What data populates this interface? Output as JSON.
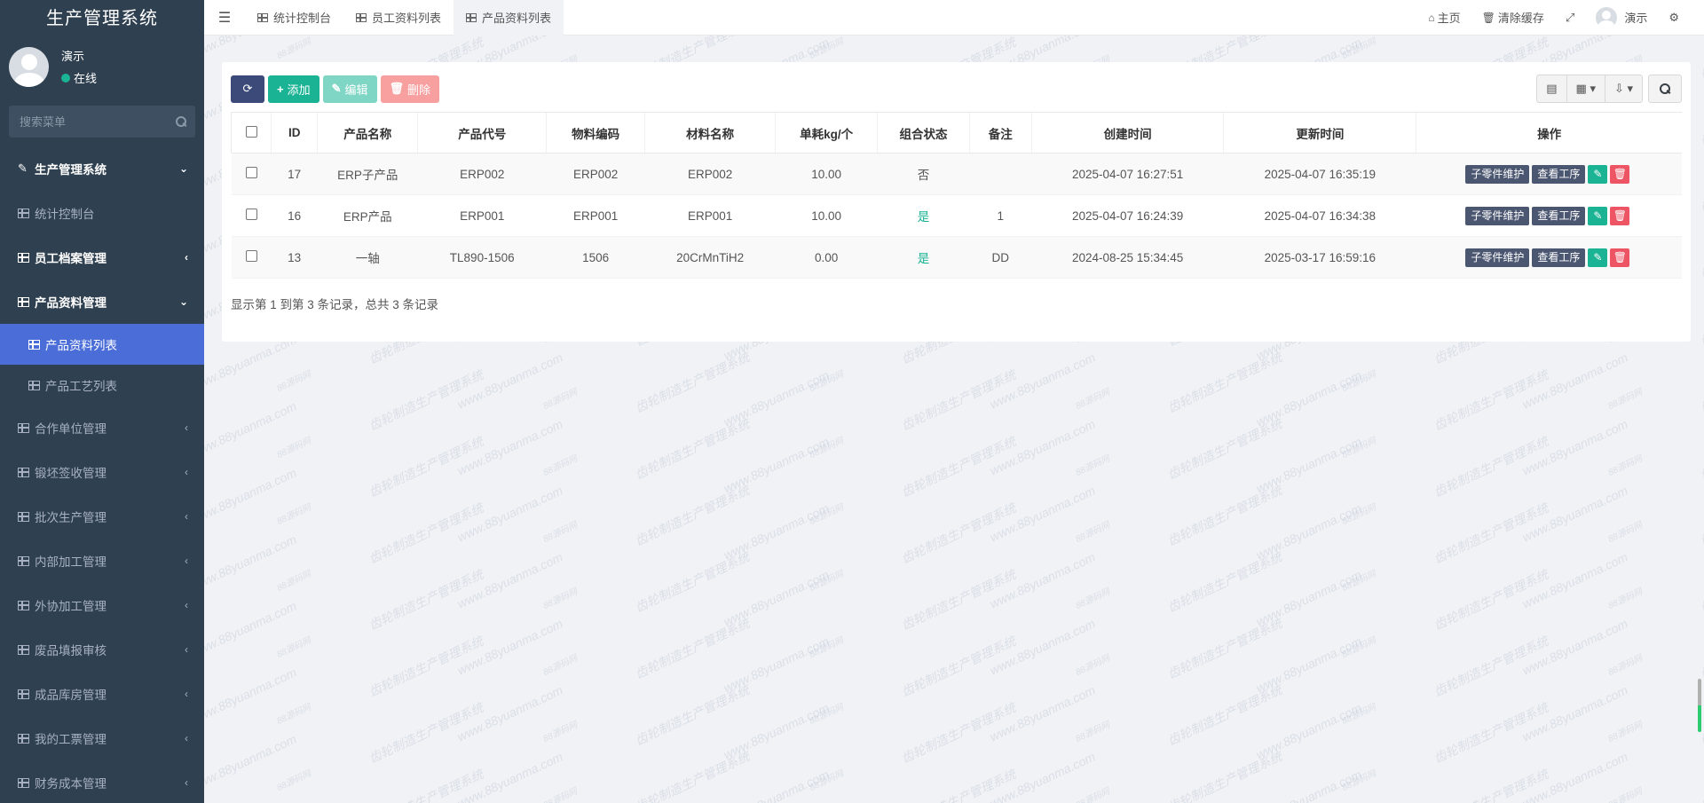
{
  "app": {
    "title": "生产管理系统"
  },
  "user": {
    "name": "演示",
    "status": "在线"
  },
  "sidebar": {
    "search_placeholder": "搜索菜单",
    "items": [
      {
        "label": "生产管理系统",
        "icon": "pencil-icon",
        "caret": "⌄",
        "bold": true
      },
      {
        "label": "统计控制台",
        "icon": "grid-icon",
        "caret": ""
      },
      {
        "label": "员工档案管理",
        "icon": "grid-icon",
        "caret": "‹",
        "bold": true
      },
      {
        "label": "产品资料管理",
        "icon": "grid-icon",
        "caret": "⌄",
        "bold": true
      },
      {
        "label": "产品资料列表",
        "icon": "grid-icon",
        "caret": "",
        "sub": true,
        "active": true
      },
      {
        "label": "产品工艺列表",
        "icon": "grid-icon",
        "caret": "",
        "sub": true
      },
      {
        "label": "合作单位管理",
        "icon": "grid-icon",
        "caret": "‹"
      },
      {
        "label": "锻坯签收管理",
        "icon": "grid-icon",
        "caret": "‹"
      },
      {
        "label": "批次生产管理",
        "icon": "grid-icon",
        "caret": "‹"
      },
      {
        "label": "内部加工管理",
        "icon": "grid-icon",
        "caret": "‹"
      },
      {
        "label": "外协加工管理",
        "icon": "grid-icon",
        "caret": "‹"
      },
      {
        "label": "废品填报审核",
        "icon": "grid-icon",
        "caret": "‹"
      },
      {
        "label": "成品库房管理",
        "icon": "grid-icon",
        "caret": "‹"
      },
      {
        "label": "我的工票管理",
        "icon": "grid-icon",
        "caret": "‹"
      },
      {
        "label": "财务成本管理",
        "icon": "grid-icon",
        "caret": "‹"
      }
    ]
  },
  "header": {
    "tabs": [
      {
        "label": "统计控制台",
        "active": false
      },
      {
        "label": "员工资料列表",
        "active": false
      },
      {
        "label": "产品资料列表",
        "active": true
      }
    ],
    "home_label": "主页",
    "clear_cache_label": "清除缓存",
    "user_label": "演示"
  },
  "toolbar": {
    "add_label": "添加",
    "edit_label": "编辑",
    "delete_label": "删除"
  },
  "table": {
    "columns": [
      "ID",
      "产品名称",
      "产品代号",
      "物料编码",
      "材料名称",
      "单耗kg/个",
      "组合状态",
      "备注",
      "创建时间",
      "更新时间",
      "操作"
    ],
    "rows": [
      {
        "id": "17",
        "name": "ERP子产品",
        "code": "ERP002",
        "material_code": "ERP002",
        "material_name": "ERP002",
        "consumption": "10.00",
        "combo": "否",
        "combo_yes": false,
        "remark": "",
        "created": "2025-04-07 16:27:51",
        "updated": "2025-04-07 16:35:19"
      },
      {
        "id": "16",
        "name": "ERP产品",
        "code": "ERP001",
        "material_code": "ERP001",
        "material_name": "ERP001",
        "consumption": "10.00",
        "combo": "是",
        "combo_yes": true,
        "remark": "1",
        "created": "2025-04-07 16:24:39",
        "updated": "2025-04-07 16:34:38"
      },
      {
        "id": "13",
        "name": "一轴",
        "code": "TL890-1506",
        "material_code": "1506",
        "material_name": "20CrMnTiH2",
        "consumption": "0.00",
        "combo": "是",
        "combo_yes": true,
        "remark": "DD",
        "created": "2024-08-25 15:34:45",
        "updated": "2025-03-17 16:59:16"
      }
    ],
    "row_actions": {
      "sub_parts": "子零件维护",
      "view_process": "查看工序"
    }
  },
  "pager": {
    "info": "显示第 1 到第 3 条记录，总共 3 条记录"
  },
  "watermark": {
    "texts": [
      "www.88yuanma.com",
      "88源码网",
      "齿轮制造生产管理系统"
    ]
  },
  "colors": {
    "sidebar_bg": "#2f4050",
    "active_item": "#4a6dd8",
    "primary": "#1ab394",
    "danger": "#ed5565",
    "dark_btn": "#3b4a79"
  }
}
